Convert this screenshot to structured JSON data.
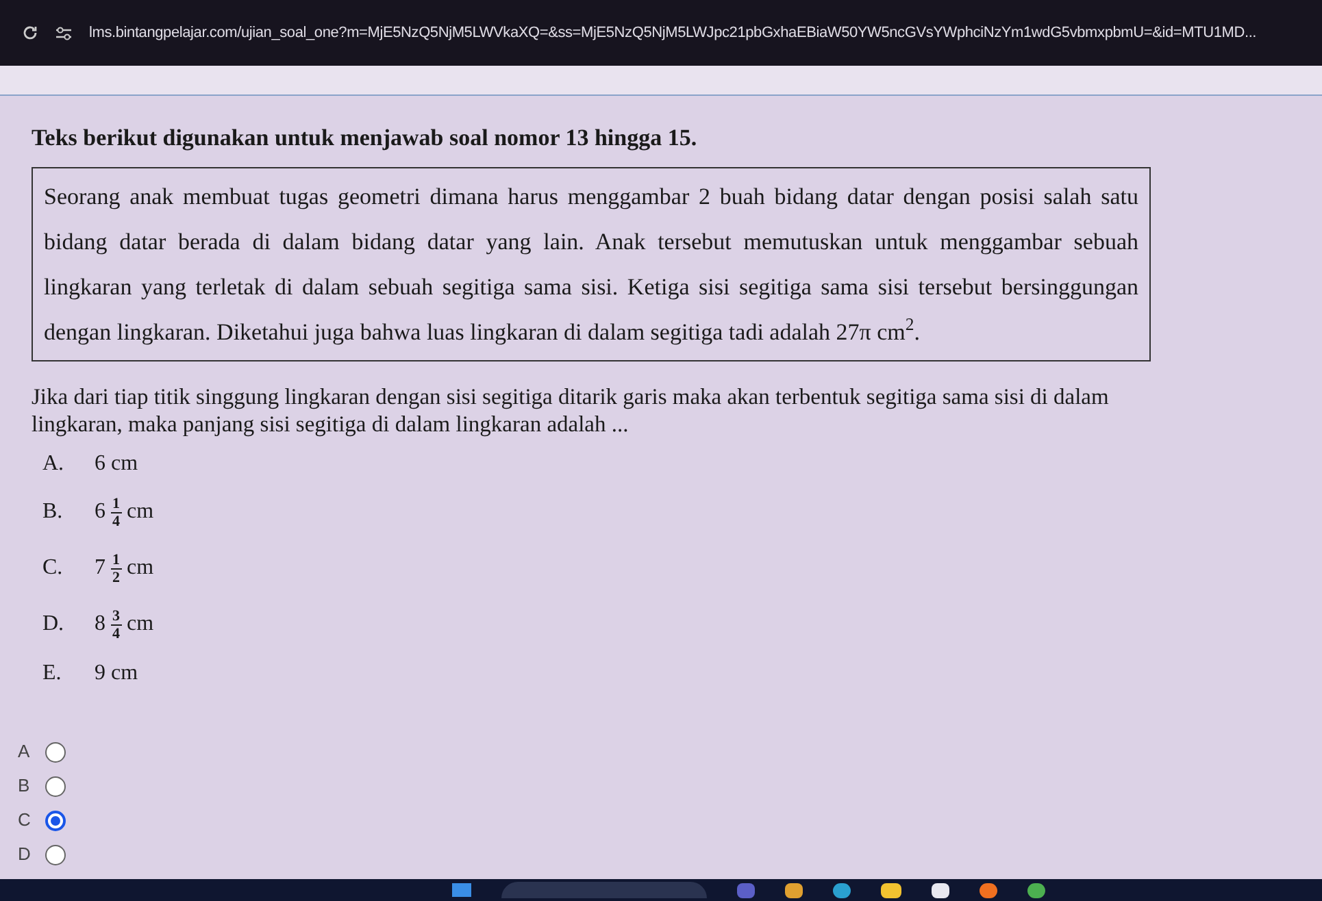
{
  "browser": {
    "url": "lms.bintangpelajar.com/ujian_soal_one?m=MjE5NzQ5NjM5LWVkaXQ=&ss=MjE5NzQ5NjM5LWJpc21pbGxhaEBiaW50YW5ncGVsYWphciNzYm1wdG5vbmxpbmU=&id=MTU1MD..."
  },
  "intro": "Teks berikut digunakan untuk menjawab soal nomor 13 hingga 15.",
  "passage": "Seorang anak membuat tugas geometri dimana harus menggambar 2 buah bidang datar dengan posisi salah satu bidang datar berada di dalam bidang datar yang lain. Anak tersebut memutuskan untuk menggambar sebuah lingkaran yang terletak di dalam sebuah segitiga sama sisi. Ketiga sisi segitiga sama sisi tersebut bersinggungan dengan lingkaran. Diketahui juga bahwa luas lingkaran di dalam segitiga tadi adalah 27π cm$^{2}$.",
  "question": "Jika dari tiap titik singgung lingkaran dengan sisi segitiga ditarik garis maka akan terbentuk segitiga sama sisi di dalam lingkaran, maka panjang sisi segitiga di dalam lingkaran adalah ...",
  "options": [
    {
      "kind": "plain",
      "letter": "A.",
      "value": "6 cm"
    },
    {
      "kind": "fraction",
      "letter": "B.",
      "whole": "6",
      "numerator": "1",
      "denominator": "4",
      "unit": "cm"
    },
    {
      "kind": "fraction",
      "letter": "C.",
      "whole": "7",
      "numerator": "1",
      "denominator": "2",
      "unit": "cm"
    },
    {
      "kind": "fraction",
      "letter": "D.",
      "whole": "8",
      "numerator": "3",
      "denominator": "4",
      "unit": "cm"
    },
    {
      "kind": "plain",
      "letter": "E.",
      "value": "9 cm"
    }
  ],
  "answers": [
    {
      "label": "A",
      "selected": false
    },
    {
      "label": "B",
      "selected": false
    },
    {
      "label": "C",
      "selected": true
    },
    {
      "label": "D",
      "selected": false
    }
  ]
}
